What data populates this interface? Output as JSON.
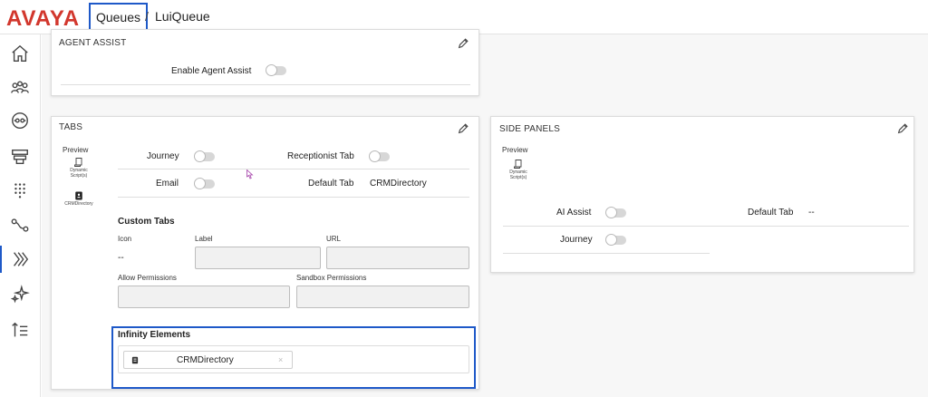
{
  "header": {
    "logo": "AVAYA",
    "breadcrumb_parent": "Queues",
    "breadcrumb_separator": "/",
    "breadcrumb_current": "LuiQueue"
  },
  "sidebar": {
    "icons": [
      "home-icon",
      "users-icon",
      "queue-icon",
      "layers-icon",
      "dialpad-icon",
      "routing-icon",
      "infinity-elements-icon",
      "sparkle-icon",
      "sort-icon"
    ]
  },
  "agent_assist": {
    "title": "AGENT ASSIST",
    "enable_label": "Enable Agent Assist"
  },
  "tabs": {
    "title": "TABS",
    "preview_label": "Preview",
    "preview_items": [
      "Dynamic Script(s)",
      "CRMDirectory"
    ],
    "journey_label": "Journey",
    "receptionist_label": "Receptionist Tab",
    "email_label": "Email",
    "default_tab_label": "Default Tab",
    "default_tab_value": "CRMDirectory",
    "custom_tabs_heading": "Custom Tabs",
    "icon_col": "Icon",
    "label_col": "Label",
    "url_col": "URL",
    "icon_value": "--",
    "allow_permissions_label": "Allow Permissions",
    "sandbox_permissions_label": "Sandbox Permissions",
    "infinity_heading": "Infinity Elements",
    "infinity_chip": "CRMDirectory",
    "chip_remove": "×"
  },
  "side_panels": {
    "title": "SIDE PANELS",
    "preview_label": "Preview",
    "preview_item": "Dynamic Script(s)",
    "ai_assist_label": "AI Assist",
    "default_tab_label": "Default Tab",
    "default_tab_value": "--",
    "journey_label": "Journey"
  },
  "colors": {
    "brand": "#d2372d",
    "highlight": "#1e59c8"
  }
}
